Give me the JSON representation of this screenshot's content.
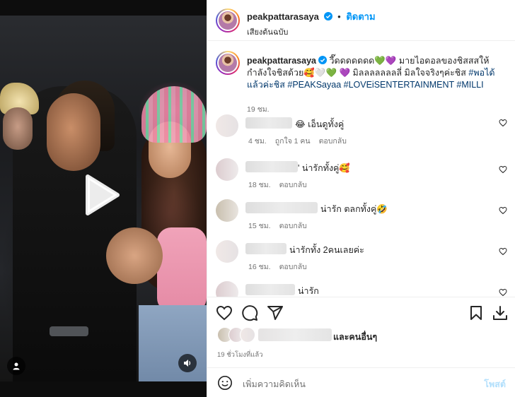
{
  "post": {
    "username": "peakpattarasaya",
    "follow_label": "ติดตาม",
    "separator": "•",
    "audio_label": "เสียงต้นฉบับ"
  },
  "caption": {
    "username": "peakpattarasaya",
    "text": " วี๊ดดดดดดด💚💜 มายไอดอลของชิสสสให้กำลังใจชิสด้วย🥰🤍💚 💜 มิลลลลลลลลี่ มิลใจจริงๆค่ะชิส ",
    "tags": "#พอได้แล้วค่ะชิส #PEAKSayaa #LOVEiSENTERTAINMENT #MILLI",
    "time": "19 ชม."
  },
  "comments": [
    {
      "text": "😂 เอ็นดูทั้งคู่",
      "time": "4 ชม.",
      "likes": "ถูกใจ 1 คน",
      "reply": "ตอบกลับ"
    },
    {
      "text": "' น่ารักทั้งคู่🥰",
      "time": "18 ชม.",
      "reply": "ตอบกลับ"
    },
    {
      "text": "น่ารัก ตลกทั้งคู่🤣",
      "time": "15 ชม.",
      "reply": "ตอบกลับ"
    },
    {
      "text": "น่ารักทั้ง 2คนเลยค่ะ",
      "time": "16 ชม.",
      "reply": "ตอบกลับ"
    },
    {
      "text": "น่ารัก"
    }
  ],
  "likes": {
    "text": "และคนอื่นๆ"
  },
  "time_ago": "19 ชั่วโมงที่แล้ว",
  "add_comment": {
    "placeholder": "เพิ่มความคิดเห็น",
    "post_label": "โพสต์"
  },
  "icons": [
    "play-icon",
    "user-icon",
    "sound-icon",
    "verified-icon",
    "heart-icon",
    "comment-icon",
    "share-icon",
    "bookmark-icon",
    "download-icon",
    "emoji-icon"
  ],
  "colors": {
    "accent": "#0095f6",
    "link": "#00376b",
    "post_disabled": "#b2dffc"
  }
}
